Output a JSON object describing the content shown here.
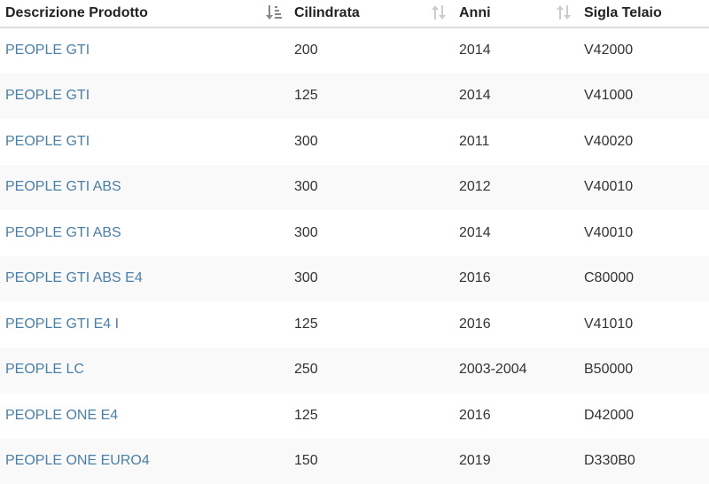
{
  "table": {
    "headers": {
      "descrizione": "Descrizione Prodotto",
      "cilindrata": "Cilindrata",
      "anni": "Anni",
      "sigla": "Sigla Telaio"
    },
    "rows": [
      {
        "descrizione": "PEOPLE GTI",
        "cilindrata": "200",
        "anni": "2014",
        "sigla": "V42000"
      },
      {
        "descrizione": "PEOPLE GTI",
        "cilindrata": "125",
        "anni": "2014",
        "sigla": "V41000"
      },
      {
        "descrizione": "PEOPLE GTI",
        "cilindrata": "300",
        "anni": "2011",
        "sigla": "V40020"
      },
      {
        "descrizione": "PEOPLE GTI ABS",
        "cilindrata": "300",
        "anni": "2012",
        "sigla": "V40010"
      },
      {
        "descrizione": "PEOPLE GTI ABS",
        "cilindrata": "300",
        "anni": "2014",
        "sigla": "V40010"
      },
      {
        "descrizione": "PEOPLE GTI ABS E4",
        "cilindrata": "300",
        "anni": "2016",
        "sigla": "C80000"
      },
      {
        "descrizione": "PEOPLE GTI E4 I",
        "cilindrata": "125",
        "anni": "2016",
        "sigla": "V41010"
      },
      {
        "descrizione": "PEOPLE LC",
        "cilindrata": "250",
        "anni": "2003-2004",
        "sigla": "B50000"
      },
      {
        "descrizione": "PEOPLE ONE E4",
        "cilindrata": "125",
        "anni": "2016",
        "sigla": "D42000"
      },
      {
        "descrizione": "PEOPLE ONE EURO4",
        "cilindrata": "150",
        "anni": "2019",
        "sigla": "D330B0"
      }
    ]
  },
  "icons": {
    "sort_active": "sort-amount-down-icon",
    "sort_inactive": "sort-both-icon"
  },
  "colors": {
    "link": "#4a7fa7",
    "stripe": "#f9f9f9",
    "sort_active": "#888888",
    "sort_inactive": "#cccccc"
  }
}
